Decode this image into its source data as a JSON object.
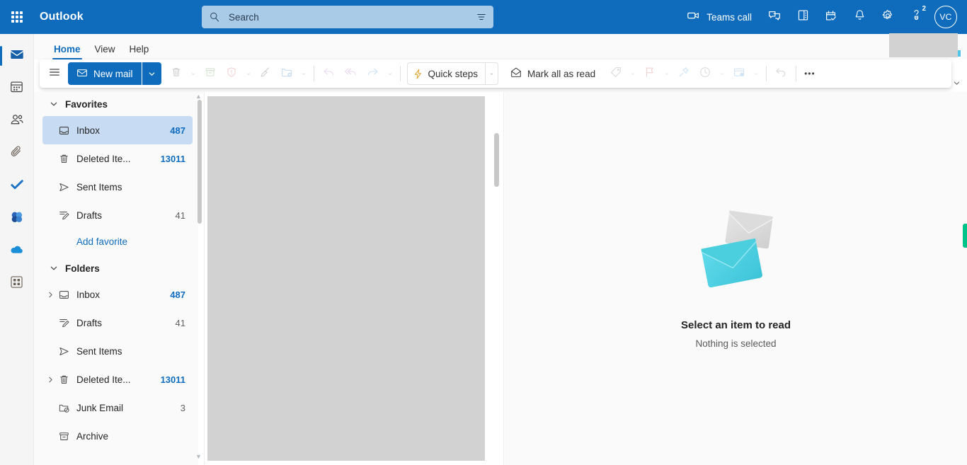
{
  "topbar": {
    "waffle_icon": "app-launcher-icon",
    "app_title": "Outlook",
    "search": {
      "placeholder": "Search",
      "value": "",
      "icon": "search-icon",
      "filter_icon": "filter-icon"
    },
    "actions": [
      {
        "name": "teams-call",
        "label": "Teams call",
        "icon": "video-camera-icon"
      },
      {
        "name": "chat",
        "label": "",
        "icon": "chat-icon"
      },
      {
        "name": "onenote",
        "label": "",
        "icon": "onenote-icon"
      },
      {
        "name": "my-day",
        "label": "",
        "icon": "calendar-check-icon"
      },
      {
        "name": "notifications",
        "label": "",
        "icon": "bell-icon"
      },
      {
        "name": "settings",
        "label": "",
        "icon": "gear-icon"
      },
      {
        "name": "help",
        "label": "",
        "icon": "question-lightbulb-icon",
        "badge": "2"
      }
    ],
    "avatar": {
      "initials": "VC"
    },
    "accent_color": "#0f6cbd",
    "search_bg_color": "#a9cbe8"
  },
  "rail": {
    "items": [
      {
        "name": "mail",
        "icon": "mail-icon",
        "active": true
      },
      {
        "name": "calendar",
        "icon": "calendar-icon",
        "active": false
      },
      {
        "name": "people",
        "icon": "people-icon",
        "active": false
      },
      {
        "name": "files",
        "icon": "paperclip-icon",
        "active": false
      },
      {
        "name": "to-do",
        "icon": "checkmark-icon",
        "active": false
      },
      {
        "name": "viva-engage",
        "icon": "viva-engage-icon",
        "active": false
      },
      {
        "name": "onedrive",
        "icon": "cloud-icon",
        "active": false
      },
      {
        "name": "more-apps",
        "icon": "grid-apps-icon",
        "active": false
      }
    ]
  },
  "ribbon": {
    "tabs": [
      {
        "label": "Home",
        "active": true
      },
      {
        "label": "View",
        "active": false
      },
      {
        "label": "Help",
        "active": false
      }
    ],
    "collapse_icon": "chevron-down-icon"
  },
  "commandbar": {
    "hamburger_icon": "hamburger-menu-icon",
    "new_mail": {
      "label": "New mail",
      "icon": "mail-icon",
      "caret_icon": "chevron-down-icon"
    },
    "delete": {
      "icon": "trash-icon",
      "caret_icon": "chevron-down-icon",
      "disabled": true
    },
    "archive": {
      "icon": "archive-icon",
      "disabled": true
    },
    "report": {
      "icon": "shield-exclamation-icon",
      "caret_icon": "chevron-down-icon",
      "disabled": true
    },
    "sweep": {
      "icon": "broom-icon",
      "disabled": true
    },
    "move_to": {
      "icon": "folder-arrow-icon",
      "caret_icon": "chevron-down-icon",
      "disabled": true
    },
    "reply": {
      "icon": "reply-icon",
      "disabled": true
    },
    "reply_all": {
      "icon": "reply-all-icon",
      "disabled": true
    },
    "forward": {
      "icon": "forward-icon",
      "caret_icon": "chevron-down-icon",
      "disabled": true
    },
    "quick_steps": {
      "label": "Quick steps",
      "icon": "lightning-bolt-icon",
      "caret_icon": "chevron-down-icon"
    },
    "mark_all_as_read": {
      "label": "Mark all as read",
      "icon": "open-envelope-icon"
    },
    "categorize": {
      "icon": "tag-icon",
      "caret_icon": "chevron-down-icon",
      "disabled": true
    },
    "flag": {
      "icon": "flag-icon",
      "caret_icon": "chevron-down-icon",
      "disabled": true
    },
    "pin": {
      "icon": "pin-icon",
      "disabled": true
    },
    "snooze": {
      "icon": "clock-icon",
      "caret_icon": "chevron-down-icon",
      "disabled": true
    },
    "rules": {
      "icon": "rules-icon",
      "caret_icon": "chevron-down-icon",
      "disabled": true
    },
    "undo": {
      "icon": "undo-icon",
      "disabled": true
    },
    "overflow": {
      "icon": "ellipsis-icon",
      "label": "•••"
    }
  },
  "folderpane": {
    "favorites": {
      "header": "Favorites",
      "chevron_icon": "chevron-down-icon",
      "items": [
        {
          "name": "inbox",
          "label": "Inbox",
          "count": "487",
          "count_style": "blue",
          "icon": "inbox-icon",
          "selected": true,
          "expander": false
        },
        {
          "name": "deleted-items",
          "label": "Deleted Ite...",
          "count": "13011",
          "count_style": "blue",
          "icon": "trash-icon",
          "selected": false,
          "expander": false
        },
        {
          "name": "sent-items",
          "label": "Sent Items",
          "count": "",
          "count_style": "grey",
          "icon": "send-icon",
          "selected": false,
          "expander": false
        },
        {
          "name": "drafts",
          "label": "Drafts",
          "count": "41",
          "count_style": "grey",
          "icon": "draft-pencil-icon",
          "selected": false,
          "expander": false
        }
      ],
      "add_favorite_label": "Add favorite"
    },
    "folders": {
      "header": "Folders",
      "chevron_icon": "chevron-down-icon",
      "items": [
        {
          "name": "inbox",
          "label": "Inbox",
          "count": "487",
          "count_style": "blue",
          "icon": "inbox-icon",
          "expander": true
        },
        {
          "name": "drafts",
          "label": "Drafts",
          "count": "41",
          "count_style": "grey",
          "icon": "draft-pencil-icon",
          "expander": false
        },
        {
          "name": "sent-items",
          "label": "Sent Items",
          "count": "",
          "count_style": "grey",
          "icon": "send-icon",
          "expander": false
        },
        {
          "name": "deleted-items",
          "label": "Deleted Ite...",
          "count": "13011",
          "count_style": "blue",
          "icon": "trash-icon",
          "expander": true
        },
        {
          "name": "junk-email",
          "label": "Junk Email",
          "count": "3",
          "count_style": "grey",
          "icon": "junk-folder-icon",
          "expander": false
        },
        {
          "name": "archive",
          "label": "Archive",
          "count": "",
          "count_style": "grey",
          "icon": "archive-icon",
          "expander": false
        }
      ]
    }
  },
  "readingpane": {
    "empty_state": {
      "illustration": "two-envelopes-illustration",
      "title": "Select an item to read",
      "subtitle": "Nothing is selected"
    },
    "side_tab": {
      "name": "feedback-tab",
      "color": "#00c389"
    }
  }
}
